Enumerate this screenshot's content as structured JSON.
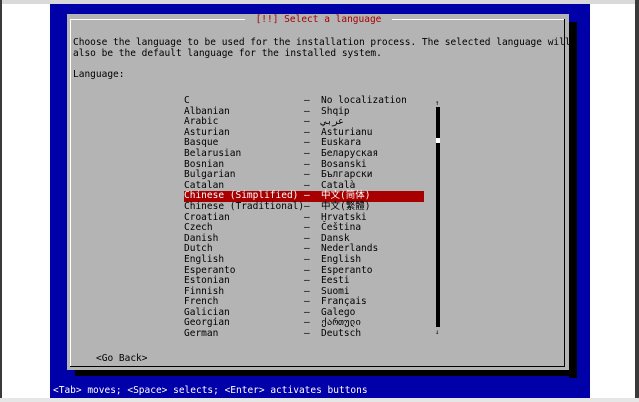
{
  "dialog": {
    "title": "[!!] Select a language",
    "prompt": "Choose the language to be used for the installation process. The selected language will\nalso be the default language for the installed system.",
    "language_label": "Language:",
    "go_back": "<Go Back>"
  },
  "languages": [
    {
      "name": "C",
      "native": "No localization"
    },
    {
      "name": "Albanian",
      "native": "Shqip"
    },
    {
      "name": "Arabic",
      "native": "عربي"
    },
    {
      "name": "Asturian",
      "native": "Asturianu"
    },
    {
      "name": "Basque",
      "native": "Euskara"
    },
    {
      "name": "Belarusian",
      "native": "Беларуская"
    },
    {
      "name": "Bosnian",
      "native": "Bosanski"
    },
    {
      "name": "Bulgarian",
      "native": "Български"
    },
    {
      "name": "Catalan",
      "native": "Català"
    },
    {
      "name": "Chinese (Simplified)",
      "native": "中文(简体)",
      "selected": true
    },
    {
      "name": "Chinese (Traditional)",
      "native": "中文(繁體)"
    },
    {
      "name": "Croatian",
      "native": "Hrvatski"
    },
    {
      "name": "Czech",
      "native": "Čeština"
    },
    {
      "name": "Danish",
      "native": "Dansk"
    },
    {
      "name": "Dutch",
      "native": "Nederlands"
    },
    {
      "name": "English",
      "native": "English"
    },
    {
      "name": "Esperanto",
      "native": "Esperanto"
    },
    {
      "name": "Estonian",
      "native": "Eesti"
    },
    {
      "name": "Finnish",
      "native": "Suomi"
    },
    {
      "name": "French",
      "native": "Français"
    },
    {
      "name": "Galician",
      "native": "Galego"
    },
    {
      "name": "Georgian",
      "native": "ქართული"
    },
    {
      "name": "German",
      "native": "Deutsch"
    }
  ],
  "separator": "–",
  "scrollbar": {
    "up": "↑",
    "down": "↓",
    "thumb": "■"
  },
  "statusbar": "<Tab> moves; <Space> selects; <Enter> activates buttons",
  "colors": {
    "screen": "#0000a8",
    "dialog": "#b4b4b4",
    "selection": "#a80000",
    "title": "#a80000"
  }
}
